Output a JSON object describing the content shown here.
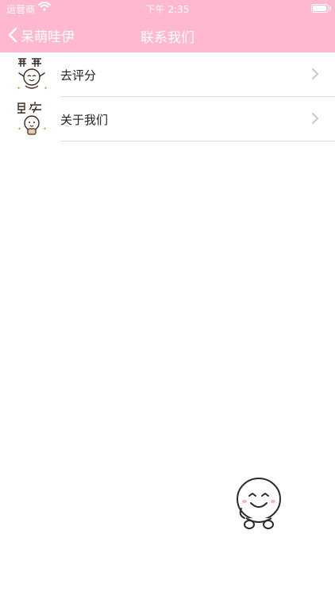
{
  "status_bar": {
    "carrier": "运营商",
    "time": "下午 2:35"
  },
  "nav": {
    "back_label": "呆萌哇伊",
    "title": "联系我们"
  },
  "rows": [
    {
      "label": "去评分",
      "icon": "cartoon-praise-icon"
    },
    {
      "label": "关于我们",
      "icon": "cartoon-morning-icon"
    }
  ],
  "colors": {
    "navbar": "#ffb8cf",
    "text": "#222222",
    "chevron": "#c7c7cc",
    "divider": "#dedede"
  }
}
